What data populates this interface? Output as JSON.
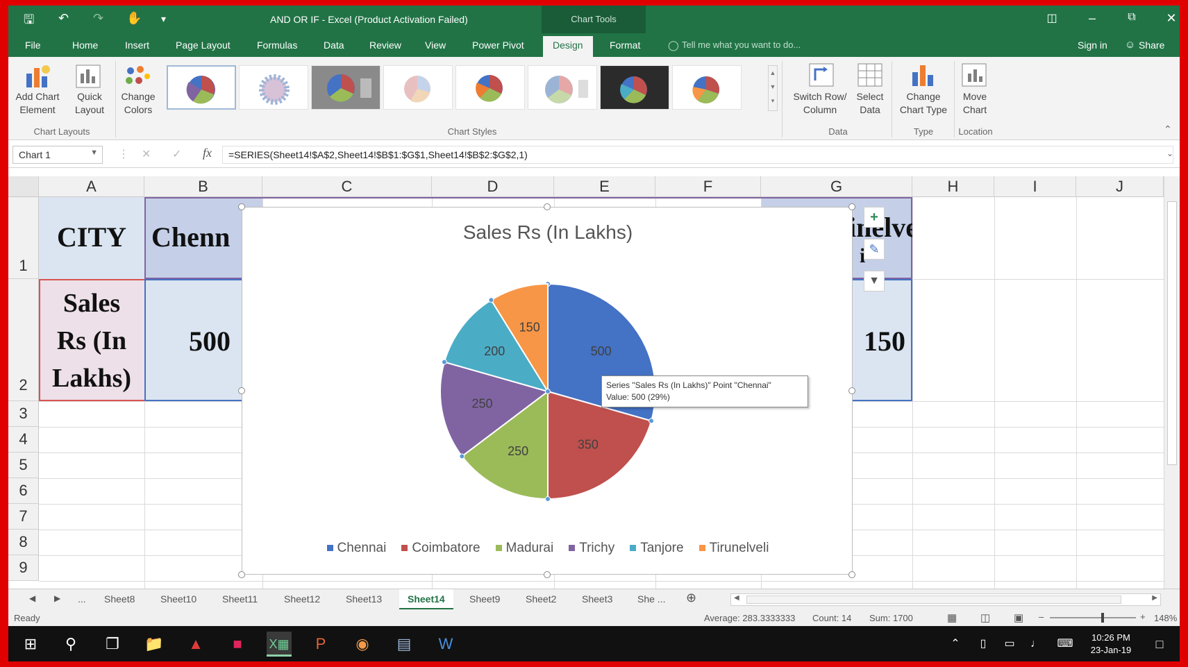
{
  "titlebar": {
    "title": "AND OR IF - Excel (Product Activation Failed)",
    "chart_tools": "Chart Tools"
  },
  "tabs": [
    {
      "label": "File"
    },
    {
      "label": "Home"
    },
    {
      "label": "Insert"
    },
    {
      "label": "Page Layout"
    },
    {
      "label": "Formulas"
    },
    {
      "label": "Data"
    },
    {
      "label": "Review"
    },
    {
      "label": "View"
    },
    {
      "label": "Power Pivot"
    },
    {
      "label": "Design"
    },
    {
      "label": "Format"
    }
  ],
  "tell_me": "Tell me what you want to do...",
  "sign_in": "Sign in",
  "share": "Share",
  "ribbon": {
    "add_chart_element": "Add Chart Element",
    "quick_layout": "Quick Layout",
    "change_colors": "Change Colors",
    "switch_row_column": "Switch Row/ Column",
    "select_data": "Select Data",
    "change_chart_type": "Change Chart Type",
    "move_chart": "Move Chart",
    "groups": {
      "chart_layouts": "Chart Layouts",
      "chart_styles": "Chart Styles",
      "data": "Data",
      "type": "Type",
      "location": "Location"
    }
  },
  "formula_bar": {
    "name_box": "Chart 1",
    "formula": "=SERIES(Sheet14!$A$2,Sheet14!$B$1:$G$1,Sheet14!$B$2:$G$2,1)"
  },
  "columns": [
    "A",
    "B",
    "C",
    "D",
    "E",
    "F",
    "G",
    "H",
    "I",
    "J"
  ],
  "rows": [
    "1",
    "2",
    "3",
    "4",
    "5",
    "6",
    "7",
    "8",
    "9"
  ],
  "cells": {
    "a1": "CITY",
    "b1": "Chenn",
    "g1": "inelvel",
    "g1_extra": "i",
    "a2_line1": "Sales",
    "a2_line2": "Rs (In",
    "a2_line3": "Lakhs)",
    "b2": "500",
    "g2": "150"
  },
  "colors": {
    "chennai": "#4472c4",
    "coimbatore": "#c0504d",
    "madurai": "#9bbb59",
    "trichy": "#8064a2",
    "tanjore": "#4bacc6",
    "tirunelveli": "#f79646"
  },
  "chart_data": {
    "type": "pie",
    "title": "Sales Rs (In Lakhs)",
    "categories": [
      "Chennai",
      "Coimbatore",
      "Madurai",
      "Trichy",
      "Tanjore",
      "Tirunelveli"
    ],
    "values": [
      500,
      350,
      250,
      250,
      200,
      150
    ],
    "data_labels": [
      "500",
      "350",
      "250",
      "250",
      "200",
      "150"
    ],
    "legend_position": "bottom",
    "tooltip": {
      "line1": "Series \"Sales Rs (In Lakhs)\" Point \"Chennai\"",
      "line2": "Value: 500 (29%)"
    }
  },
  "sheets": {
    "ellipsis": "...",
    "tabs": [
      "Sheet8",
      "Sheet10",
      "Sheet11",
      "Sheet12",
      "Sheet13",
      "Sheet14",
      "Sheet9",
      "Sheet2",
      "Sheet3",
      "She ..."
    ],
    "active": "Sheet14"
  },
  "status": {
    "ready": "Ready",
    "average": "Average: 283.3333333",
    "count": "Count: 14",
    "sum": "Sum: 1700",
    "zoom": "148%"
  },
  "taskbar": {
    "time": "10:26 PM",
    "date": "23-Jan-19"
  }
}
